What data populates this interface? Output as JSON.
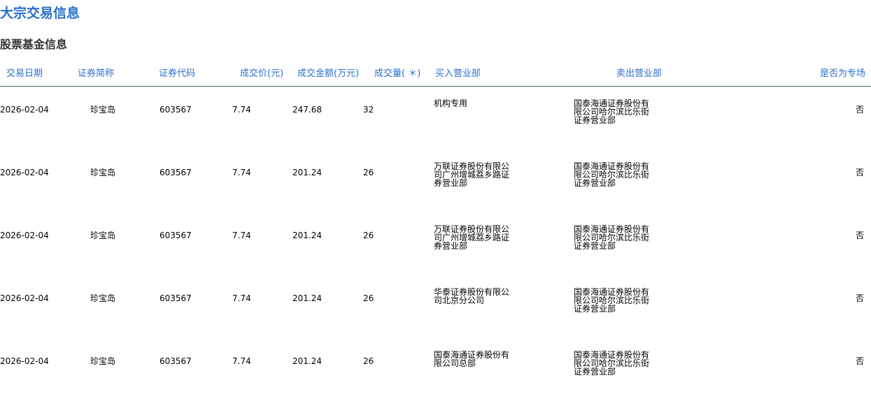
{
  "page": {
    "title": "大宗交易信息",
    "section_title": "股票基金信息"
  },
  "table": {
    "headers": {
      "date": "交易日期",
      "name": "证券简称",
      "code": "证券代码",
      "price": "成交价(元)",
      "amount": "成交金额(万元)",
      "volume": "成交量( ＊)",
      "buyer": "买入营业部",
      "seller": "卖出营业部",
      "special": "是否为专场"
    },
    "rows": [
      {
        "date": "2026-02-04",
        "name": "珍宝岛",
        "code": "603567",
        "price": "7.74",
        "amount": "247.68",
        "volume": "32",
        "buyer": "机构专用",
        "seller": "国泰海通证券股份有限公司哈尔滨比乐街证券营业部",
        "special": "否"
      },
      {
        "date": "2026-02-04",
        "name": "珍宝岛",
        "code": "603567",
        "price": "7.74",
        "amount": "201.24",
        "volume": "26",
        "buyer": "万联证券股份有限公司广州增城荔乡路证券营业部",
        "seller": "国泰海通证券股份有限公司哈尔滨比乐街证券营业部",
        "special": "否"
      },
      {
        "date": "2026-02-04",
        "name": "珍宝岛",
        "code": "603567",
        "price": "7.74",
        "amount": "201.24",
        "volume": "26",
        "buyer": "万联证券股份有限公司广州增城荔乡路证券营业部",
        "seller": "国泰海通证券股份有限公司哈尔滨比乐街证券营业部",
        "special": "否"
      },
      {
        "date": "2026-02-04",
        "name": "珍宝岛",
        "code": "603567",
        "price": "7.74",
        "amount": "201.24",
        "volume": "26",
        "buyer": "华泰证券股份有限公司北京分公司",
        "seller": "国泰海通证券股份有限公司哈尔滨比乐街证券营业部",
        "special": "否"
      },
      {
        "date": "2026-02-04",
        "name": "珍宝岛",
        "code": "603567",
        "price": "7.74",
        "amount": "201.24",
        "volume": "26",
        "buyer": "国泰海通证券股份有限公司总部",
        "seller": "国泰海通证券股份有限公司哈尔滨比乐街证券营业部",
        "special": "否"
      }
    ]
  }
}
